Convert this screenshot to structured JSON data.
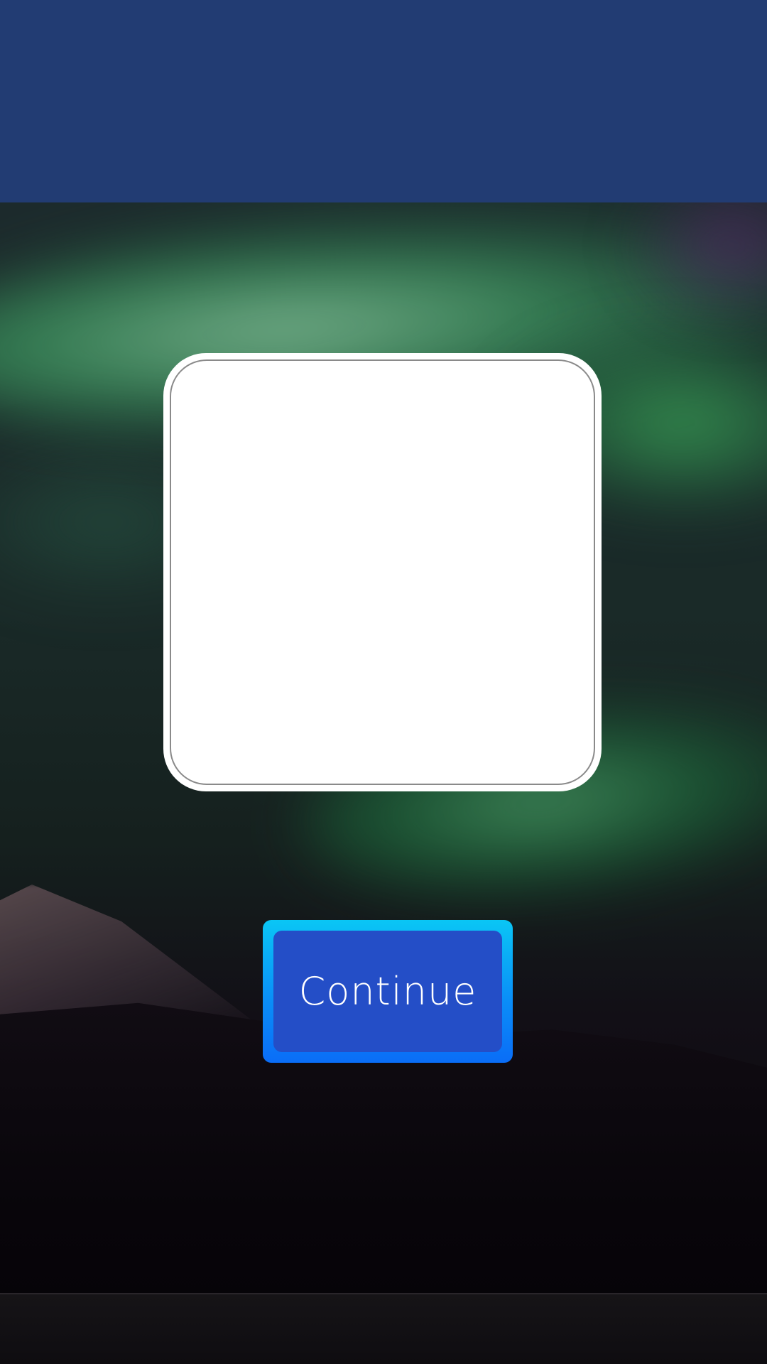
{
  "colors": {
    "top_bar": "#223c73",
    "card": "#ffffff",
    "button_outer": "#0a8ff8",
    "button_face": "#244ec7",
    "button_text": "#ffffff"
  },
  "background": {
    "icon": "aurora-landscape-image"
  },
  "card": {
    "icon": "blank-image-placeholder"
  },
  "continue_button": {
    "label": "Continue"
  }
}
